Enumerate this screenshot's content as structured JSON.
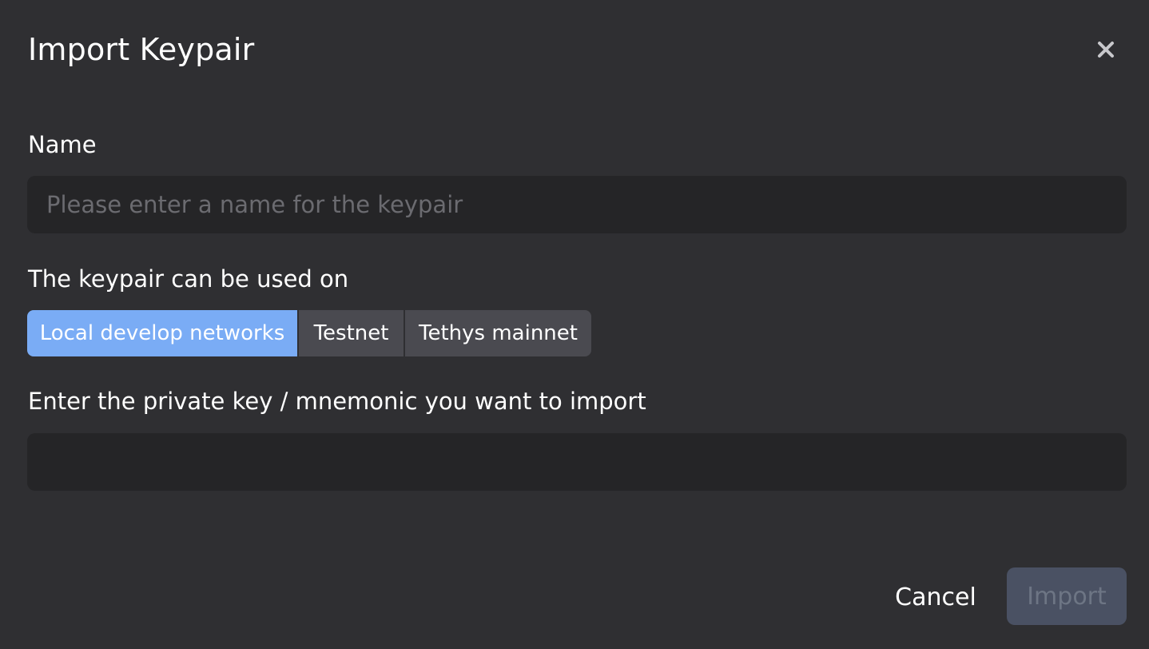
{
  "dialog": {
    "title": "Import Keypair",
    "close_icon": "close-icon"
  },
  "name_field": {
    "label": "Name",
    "value": "",
    "placeholder": "Please enter a name for the keypair"
  },
  "networks": {
    "label": "The keypair can be used on",
    "options": [
      {
        "label": "Local develop networks",
        "selected": true
      },
      {
        "label": "Testnet",
        "selected": false
      },
      {
        "label": "Tethys mainnet",
        "selected": false
      }
    ]
  },
  "key_field": {
    "label": "Enter the private key / mnemonic you want to import",
    "value": "",
    "placeholder": ""
  },
  "footer": {
    "cancel_label": "Cancel",
    "import_label": "Import",
    "import_disabled": true
  },
  "colors": {
    "background": "#2f2f32",
    "input_bg": "#252527",
    "accent": "#7aacf5",
    "segment_bg": "#4a4a50",
    "disabled_button": "#4a5163"
  }
}
